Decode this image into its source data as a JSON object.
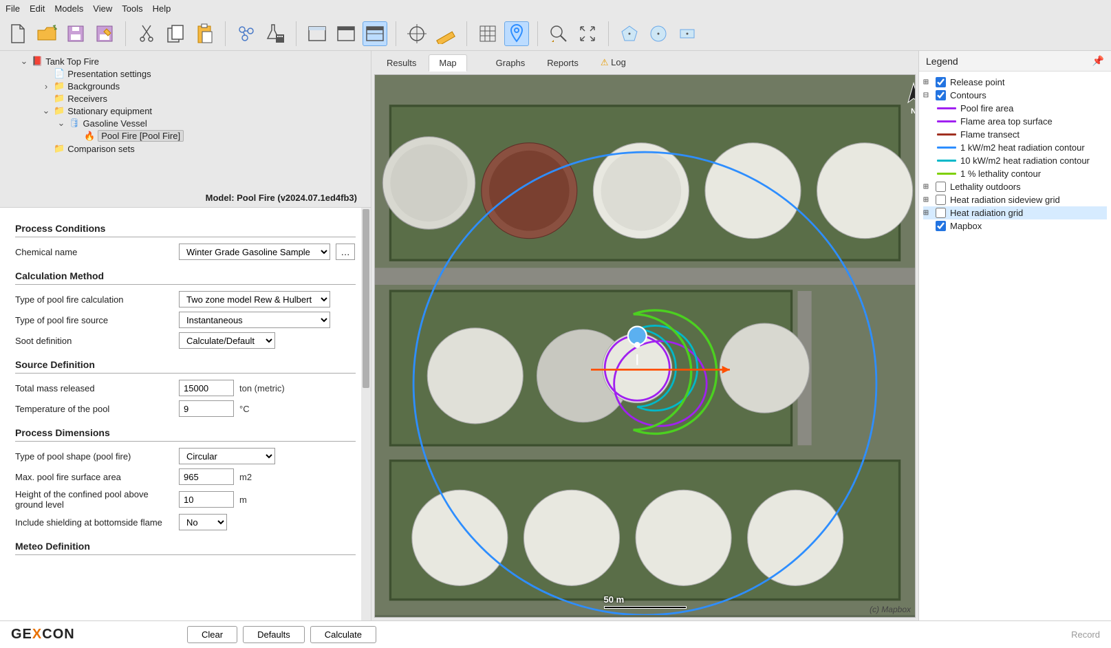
{
  "menubar": [
    "File",
    "Edit",
    "Models",
    "View",
    "Tools",
    "Help"
  ],
  "tree": {
    "root": "Tank Top Fire",
    "items": [
      "Presentation settings",
      "Backgrounds",
      "Receivers",
      "Stationary equipment",
      "Gasoline Vessel",
      "Pool Fire [Pool Fire]",
      "Comparison sets"
    ]
  },
  "model_header": "Model: Pool Fire (v2024.07.1ed4fb3)",
  "sections": {
    "process_conditions": "Process Conditions",
    "calc_method": "Calculation Method",
    "source_def": "Source Definition",
    "process_dim": "Process Dimensions",
    "meteo": "Meteo Definition"
  },
  "props": {
    "chemical_name": {
      "label": "Chemical name",
      "value": "Winter Grade Gasoline Sample"
    },
    "pool_calc_type": {
      "label": "Type of pool fire calculation",
      "value": "Two zone model Rew & Hulbert"
    },
    "pool_source_type": {
      "label": "Type of pool fire source",
      "value": "Instantaneous"
    },
    "soot": {
      "label": "Soot definition",
      "value": "Calculate/Default"
    },
    "total_mass": {
      "label": "Total mass released",
      "value": "15000",
      "unit": "ton (metric)"
    },
    "pool_temp": {
      "label": "Temperature of the pool",
      "value": "9",
      "unit": "°C"
    },
    "pool_shape": {
      "label": "Type of pool shape (pool fire)",
      "value": "Circular"
    },
    "max_area": {
      "label": "Max. pool fire surface area",
      "value": "965",
      "unit": "m2"
    },
    "pool_height": {
      "label": "Height of the confined pool above ground level",
      "value": "10",
      "unit": "m"
    },
    "shielding": {
      "label": "Include shielding at bottomside flame",
      "value": "No"
    }
  },
  "tabs": [
    "Results",
    "Map",
    "Graphs",
    "Reports",
    "Log"
  ],
  "active_tab": "Map",
  "scale_label": "50 m",
  "attribution": "(c) Mapbox",
  "legend": {
    "title": "Legend",
    "release_point": "Release point",
    "contours": "Contours",
    "items": [
      {
        "label": "Pool fire area",
        "color": "#a020f0"
      },
      {
        "label": "Flame area top surface",
        "color": "#a020f0"
      },
      {
        "label": "Flame transect",
        "color": "#a03020"
      },
      {
        "label": "1 kW/m2 heat radiation contour",
        "color": "#2e8eff"
      },
      {
        "label": "10 kW/m2 heat radiation contour",
        "color": "#00b8c8"
      },
      {
        "label": "1 % lethality contour",
        "color": "#7ed000"
      }
    ],
    "lethality": "Lethality outdoors",
    "sideview": "Heat radiation sideview grid",
    "heatgrid": "Heat radiation grid",
    "mapbox": "Mapbox"
  },
  "footer": {
    "clear": "Clear",
    "defaults": "Defaults",
    "calculate": "Calculate",
    "record": "Record"
  }
}
